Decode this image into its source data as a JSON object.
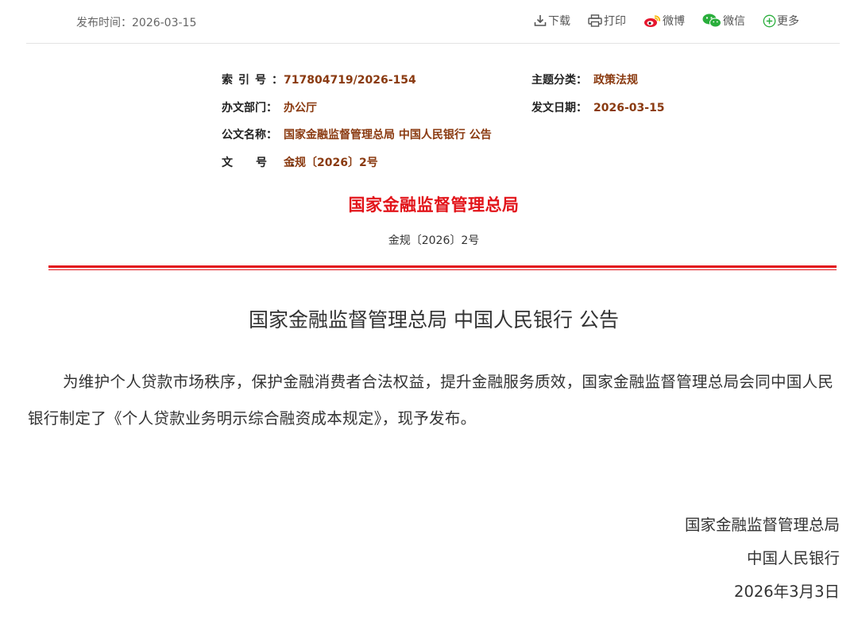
{
  "toolbar": {
    "publish_time": "发布时间：2026-03-15",
    "download": "下载",
    "print": "打印",
    "weibo": "微博",
    "wechat": "微信",
    "more": "更多",
    "colors": {
      "weibo_red": "#e6162d",
      "weibo_yellow": "#f7b500",
      "wechat_green": "#2aae3c",
      "more_green": "#2aae3c"
    }
  },
  "meta": {
    "index_label": "索引号：",
    "index_value": "717804719/2026-154",
    "topic_label": "主题分类：",
    "topic_value": "政策法规",
    "dept_label": "办文部门：",
    "dept_value": "办公厅",
    "date_label": "发文日期：",
    "date_value": "2026-03-15",
    "name_label": "公文名称：",
    "name_value": "国家金融监督管理总局 中国人民银行 公告",
    "docno_label": "文号：",
    "docno_value": "金规〔2026〕2号"
  },
  "header": {
    "issuer": "国家金融监督管理总局",
    "doc_number": "金规〔2026〕2号",
    "accent_color": "#e2141a"
  },
  "content": {
    "title": "国家金融监督管理总局 中国人民银行 公告",
    "paragraph": "为维护个人贷款市场秩序，保护金融消费者合法权益，提升金融服务质效，国家金融监督管理总局会同中国人民银行制定了《个人贷款业务明示综合融资成本规定》，现予发布。",
    "signature_1": "国家金融监督管理总局",
    "signature_2": "中国人民银行",
    "signature_date": "2026年3月3日"
  }
}
